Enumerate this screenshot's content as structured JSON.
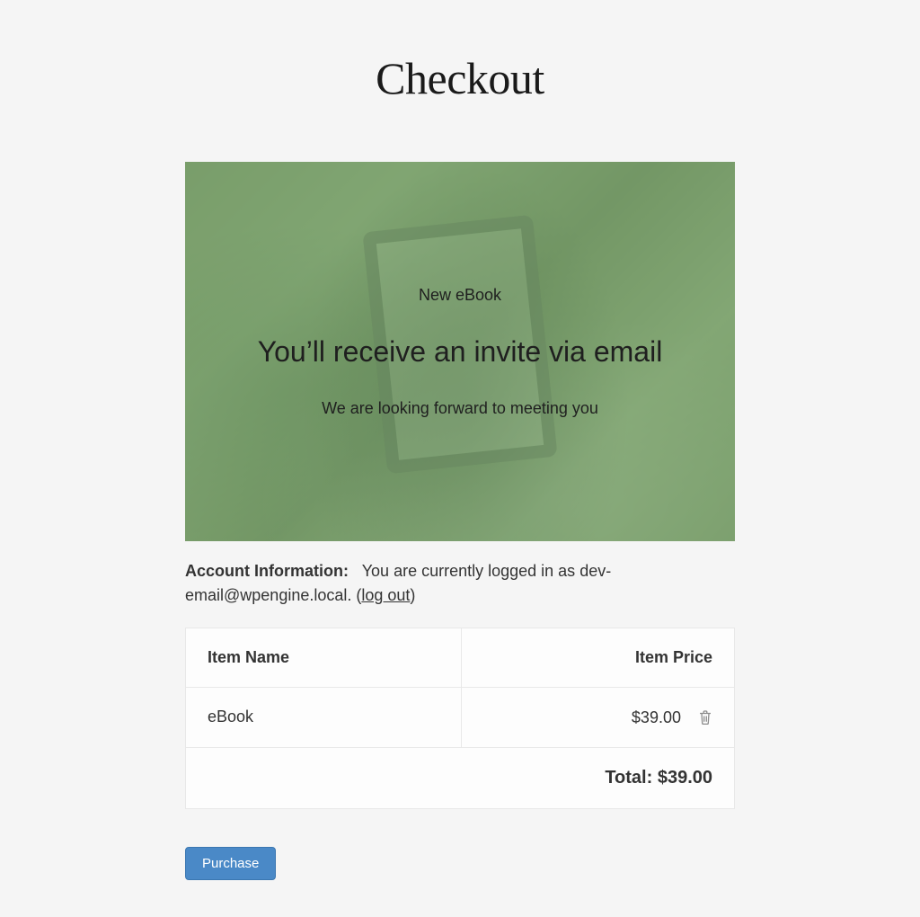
{
  "page": {
    "title": "Checkout"
  },
  "hero": {
    "eyebrow": "New eBook",
    "headline": "You’ll receive an invite via email",
    "sub": "We are looking forward to meeting you"
  },
  "account": {
    "label": "Account Information:",
    "logged_in_prefix": "You are currently logged in as ",
    "email": "dev-email@wpengine.local",
    "logged_in_suffix1": ". (",
    "logout_label": "log out",
    "logged_in_suffix2": ")"
  },
  "cart": {
    "headers": {
      "name": "Item Name",
      "price": "Item Price"
    },
    "items": [
      {
        "name": "eBook",
        "price": "$39.00"
      }
    ],
    "total_label": "Total: ",
    "total_value": "$39.00"
  },
  "actions": {
    "purchase": "Purchase"
  }
}
